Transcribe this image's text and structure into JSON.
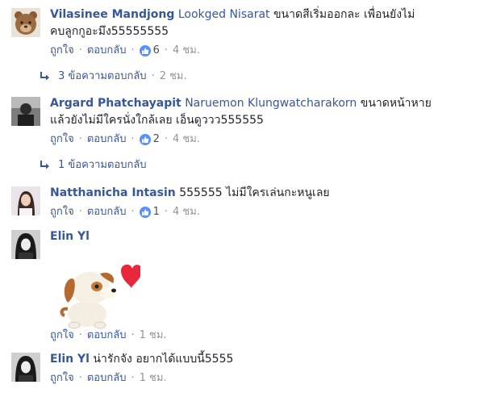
{
  "comments": [
    {
      "author": "Vilasinee Mandjong",
      "mention": "Lookged Nisarat",
      "text_line1": "ขนาดสีเริ่มออกละ เพื่อนยังไม่",
      "text_line2": "คบลูกกูอะมึง55555555",
      "like_label": "ถูกใจ",
      "reply_label": "ตอบกลับ",
      "reactions": "6",
      "time": "4 ชม.",
      "replies": {
        "label": "3 ข้อความตอบกลับ",
        "time": "2 ชม."
      }
    },
    {
      "author": "Argard Phatchayapit",
      "mention": "Naruemon Klungwatcharakorn",
      "text_line1": "ขนาดหน้าหาย",
      "text_line2": "แล้วยังไม่มีใครนั่งใกล้เลย เอ็นดูววว555555",
      "like_label": "ถูกใจ",
      "reply_label": "ตอบกลับ",
      "reactions": "2",
      "time": "4 ชม.",
      "replies": {
        "label": "1 ข้อความตอบกลับ"
      }
    },
    {
      "author": "Natthanicha Intasin",
      "text_line1": "555555 ไม่มีใครเล่นกะหนูเลย",
      "like_label": "ถูกใจ",
      "reply_label": "ตอบกลับ",
      "reactions": "1",
      "time": "4 ชม."
    },
    {
      "author": "Elin Yl",
      "sticker": "puppy-heart-sticker",
      "like_label": "ถูกใจ",
      "reply_label": "ตอบกลับ",
      "time": "1 ชม."
    },
    {
      "author": "Elin Yl",
      "text_line1": "น่ารักจัง อยากได้แบบนี้5555",
      "like_label": "ถูกใจ",
      "reply_label": "ตอบกลับ",
      "time": "1 ชม."
    }
  ],
  "sep": "·",
  "colors": {
    "name": "#365899",
    "meta": "#90949c",
    "like_badge": "#5890ff",
    "sticker_heart": "#e8283a"
  },
  "icons": [
    "thumbs-up-icon",
    "reply-arrow-icon"
  ]
}
